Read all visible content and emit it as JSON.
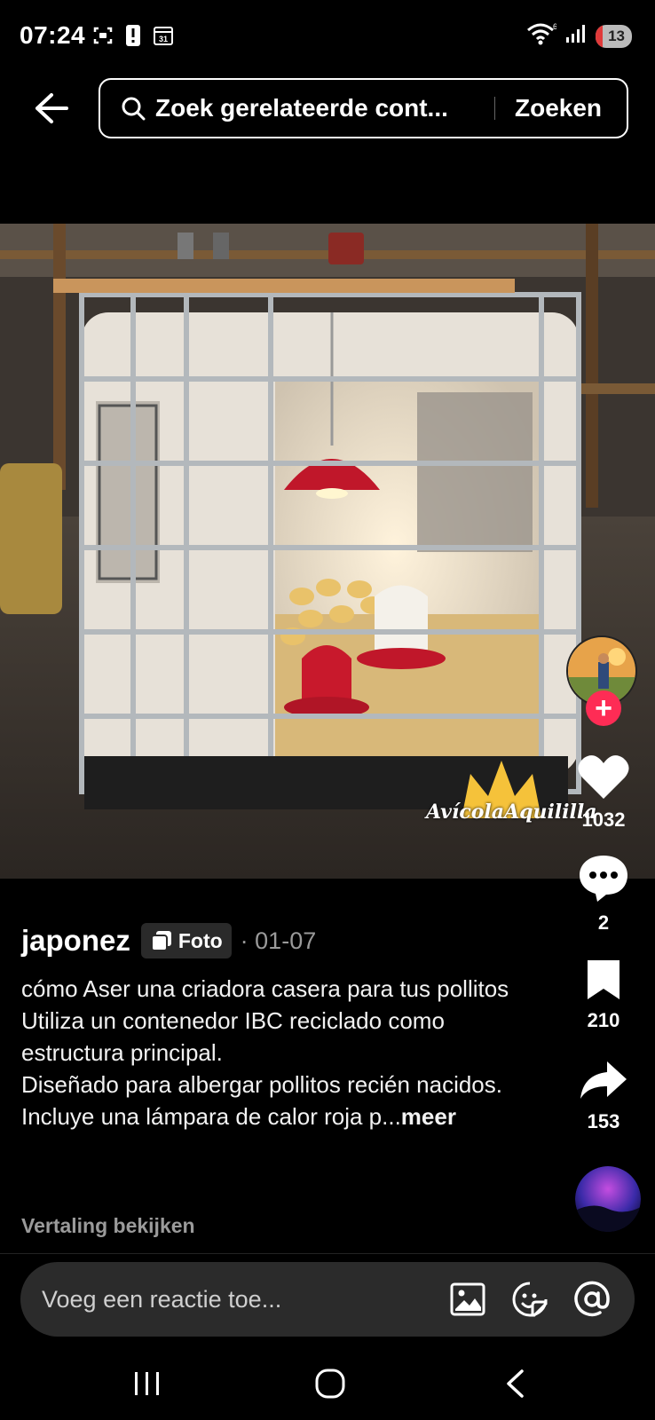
{
  "status": {
    "time": "07:24",
    "battery": "13",
    "icons": [
      "screenshot-icon",
      "alert-icon",
      "calendar-icon",
      "wifi-icon",
      "signal-icon",
      "battery-icon"
    ]
  },
  "search": {
    "query": "Zoek gerelateerde cont...",
    "button": "Zoeken"
  },
  "photo": {
    "watermark": "AvícolaAquililla"
  },
  "actions": {
    "likes": "1032",
    "comments": "2",
    "saves": "210",
    "shares": "153"
  },
  "post": {
    "author": "japonez",
    "badge": "Foto",
    "date": "· 01-07",
    "caption_lines": [
      "cómo Aser una criadora casera para tus pollitos",
      "Utiliza un contenedor IBC reciclado como estructura principal.",
      "Diseñado para albergar pollitos recién nacidos.",
      "Incluye una lámpara de calor roja p..."
    ],
    "more": "meer",
    "translate": "Vertaling bekijken"
  },
  "comment": {
    "placeholder": "Voeg een reactie toe..."
  },
  "colors": {
    "accent": "#fe2c55",
    "background": "#000000",
    "comment_box": "#2b2b2b"
  }
}
